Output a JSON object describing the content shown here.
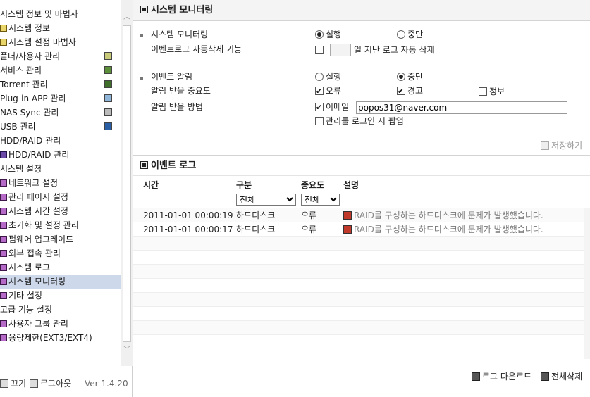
{
  "sidebar": {
    "items": [
      {
        "label": "시스템 정보 및 마법사",
        "icon": "none",
        "level": 1
      },
      {
        "label": "시스템 정보",
        "icon": "system-info-icon",
        "level": 2
      },
      {
        "label": "시스템 설정 마법사",
        "icon": "system-info-icon",
        "level": 2
      },
      {
        "label": "폴더/사용자 관리",
        "icon": "folder-user-icon",
        "level": 1
      },
      {
        "label": "서비스 관리",
        "icon": "service-icon",
        "level": 1
      },
      {
        "label": "Torrent 관리",
        "icon": "torrent-icon",
        "level": 1
      },
      {
        "label": "Plug-in APP 관리",
        "icon": "plugin-icon",
        "level": 1
      },
      {
        "label": "NAS Sync 관리",
        "icon": "nas-sync-icon",
        "level": 1
      },
      {
        "label": "USB 관리",
        "icon": "usb-icon",
        "level": 1
      },
      {
        "label": "HDD/RAID 관리",
        "icon": "none",
        "level": 1
      },
      {
        "label": "HDD/RAID 관리",
        "icon": "hdd-icon",
        "level": 2
      },
      {
        "label": "시스템 설정",
        "icon": "none",
        "level": 1
      },
      {
        "label": "네트워크 설정",
        "icon": "settings-icon",
        "level": 2
      },
      {
        "label": "관리 페이지 설정",
        "icon": "settings-icon",
        "level": 2
      },
      {
        "label": "시스템 시간 설정",
        "icon": "settings-icon",
        "level": 2
      },
      {
        "label": "초기화 및 설정 관리",
        "icon": "settings-icon",
        "level": 2
      },
      {
        "label": "펌웨어 업그레이드",
        "icon": "settings-icon",
        "level": 2
      },
      {
        "label": "외부 접속 관리",
        "icon": "settings-icon",
        "level": 2
      },
      {
        "label": "시스템 로그",
        "icon": "settings-icon",
        "level": 2
      },
      {
        "label": "시스템 모니터링",
        "icon": "settings-icon",
        "level": 2,
        "selected": true
      },
      {
        "label": "기타 설정",
        "icon": "settings-icon",
        "level": 2
      },
      {
        "label": "고급 기능 설정",
        "icon": "none",
        "level": 1
      },
      {
        "label": "사용자 그룹 관리",
        "icon": "settings-icon",
        "level": 2
      },
      {
        "label": "용량제한(EXT3/EXT4)",
        "icon": "settings-icon",
        "level": 2
      }
    ],
    "footer": {
      "off_label": "끄기",
      "logout_label": "로그아웃",
      "version": "Ver 1.4.20"
    }
  },
  "monitor": {
    "title": "시스템 모니터링",
    "system_monitoring_label": "시스템 모니터링",
    "auto_delete_label": "이벤트로그 자동삭제 기능",
    "run_label": "실행",
    "stop_label": "중단",
    "days_suffix": "일 지난 로그 자동 삭제",
    "event_alarm_label": "이벤트 알림",
    "alarm_importance_label": "알림 받을 중요도",
    "alarm_method_label": "알림 받을 방법",
    "error_label": "오류",
    "warning_label": "경고",
    "info_label": "정보",
    "email_label": "이메일",
    "email_value": "popos31@naver.com",
    "admin_popup_label": "관리툴 로그인 시 팝업",
    "save_label": "저장하기"
  },
  "event_log": {
    "title": "이벤트 로그",
    "columns": {
      "time": "시간",
      "category": "구분",
      "severity": "중요도",
      "description": "설명"
    },
    "category_filter": "전체",
    "severity_filter": "전체",
    "rows": [
      {
        "time": "2011-01-01 00:00:19",
        "category": "하드디스크",
        "severity": "오류",
        "raid": "RAID",
        "description": "를 구성하는 하드디스크에 문제가 발생했습니다."
      },
      {
        "time": "2011-01-01 00:00:17",
        "category": "하드디스크",
        "severity": "오류",
        "raid": "RAID",
        "description": "를 구성하는 하드디스크에 문제가 발생했습니다."
      }
    ],
    "download_label": "로그 다운로드",
    "delete_all_label": "전체삭제"
  }
}
